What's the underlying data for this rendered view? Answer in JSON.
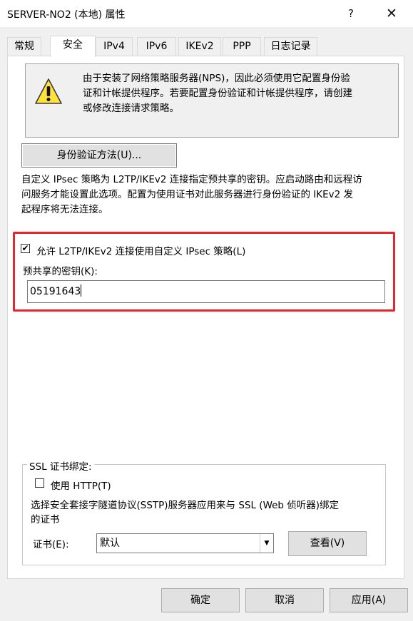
{
  "window": {
    "title": "SERVER-NO2 (本地) 属性",
    "help_glyph": "?",
    "close_glyph": "✕"
  },
  "tabs": [
    {
      "label": "常规",
      "active": false
    },
    {
      "label": "安全",
      "active": true
    },
    {
      "label": "IPv4",
      "active": false
    },
    {
      "label": "IPv6",
      "active": false
    },
    {
      "label": "IKEv2",
      "active": false
    },
    {
      "label": "PPP",
      "active": false
    },
    {
      "label": "日志记录",
      "active": false
    }
  ],
  "notice": {
    "icon": "warning-icon",
    "lines": [
      "由于安装了网络策略服务器(NPS)，因此必须使用它配置身份验",
      "证和计帐提供程序。若要配置身份验证和计帐提供程序，请创建",
      "或修改连接请求策略。"
    ]
  },
  "auth_button_label": "身份验证方法(U)...",
  "description_lines": [
    "自定义 IPsec 策略为 L2TP/IKEv2 连接指定预共享的密钥。应启动路由和远程访",
    "问服务才能设置此选项。配置为使用证书对此服务器进行身份验证的 IKEv2 发",
    "起程序将无法连接。"
  ],
  "custom_policy": {
    "checked": true,
    "check_glyph": "✔",
    "label": "允许 L2TP/IKEv2 连接使用自定义 IPsec 策略(L)",
    "psk_label": "预共享的密钥(K):",
    "psk_value": "05191643"
  },
  "ssl": {
    "group_title": "SSL 证书绑定:",
    "use_http_checked": false,
    "use_http_label": "使用 HTTP(T)",
    "desc_lines": [
      "选择安全套接字隧道协议(SSTP)服务器应用来与 SSL (Web 侦听器)绑定",
      "的证书"
    ],
    "cert_label": "证书(E):",
    "cert_value": "默认",
    "view_button_label": "查看(V)"
  },
  "footer": {
    "ok_label": "确定",
    "cancel_label": "取消",
    "apply_label": "应用(A)"
  },
  "colors": {
    "highlight_border": "#e8252c",
    "dialog_bg": "#f0f0f0",
    "warning_yellow": "#ffe33c"
  }
}
